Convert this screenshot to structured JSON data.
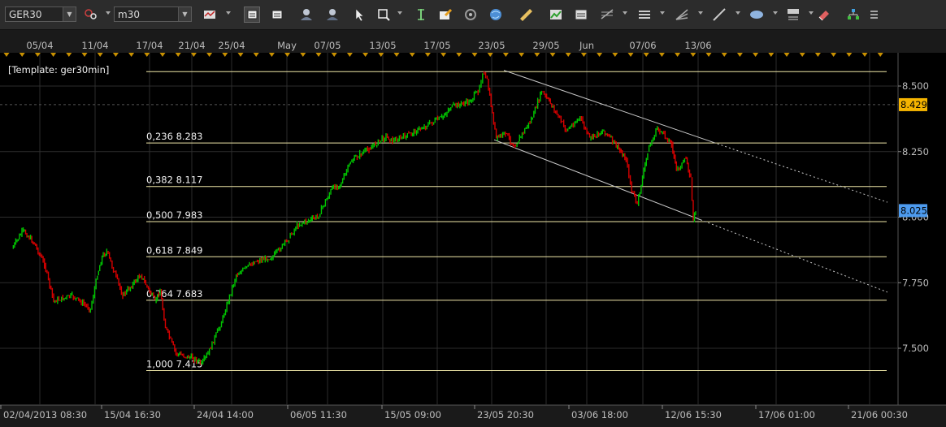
{
  "toolbar": {
    "symbol": "GER30",
    "timeframe": "m30",
    "buttons": [
      "crosshair-icon",
      "bar-type-icon",
      "view-mode-1-icon",
      "view-mode-2-icon",
      "user-icon",
      "user-2-icon",
      "cursor-icon",
      "zoom-icon",
      "vertical-line-icon",
      "edit-icon",
      "refresh-icon",
      "globe-icon",
      "ruler-icon",
      "indicator-icon",
      "drawing-panel-icon",
      "fibonacci-icon",
      "channel-icon",
      "fan-icon",
      "trendline-icon",
      "ellipse-icon",
      "text-label-icon",
      "eraser-icon",
      "tree-icon",
      "menu-icon"
    ]
  },
  "chart_data": {
    "type": "line",
    "instrument": "GER30",
    "timeframe": "m30",
    "template_label": "[Template: ger30min]",
    "y_ticks": [
      "8.500",
      "8.250",
      "8.000",
      "7.750",
      "7.500"
    ],
    "y_tick_values": [
      8500,
      8250,
      8000,
      7750,
      7500
    ],
    "ylim": [
      7360,
      8600
    ],
    "top_time_labels": [
      "05/04",
      "11/04",
      "17/04",
      "21/04",
      "25/04",
      "May",
      "07/05",
      "13/05",
      "17/05",
      "23/05",
      "29/05",
      "Jun",
      "07/06",
      "13/06"
    ],
    "bottom_time_labels": [
      "02/04/2013 08:30",
      "15/04 16:30",
      "24/04 14:00",
      "06/05 11:30",
      "15/05 09:00",
      "23/05 20:30",
      "03/06 18:00",
      "12/06 15:30",
      "17/06 01:00",
      "21/06 00:30"
    ],
    "price_badges": [
      {
        "label": "8.429",
        "value": 8429,
        "color": "#f5b400"
      },
      {
        "label": "8.025",
        "value": 8025,
        "color": "#4d9bef"
      }
    ],
    "fibonacci_levels": [
      {
        "label": "",
        "value": 8555
      },
      {
        "label": "0,236 8.283",
        "value": 8283
      },
      {
        "label": "0,382 8.117",
        "value": 8117
      },
      {
        "label": "0,500 7.983",
        "value": 7983
      },
      {
        "label": "0,618 7.849",
        "value": 7849
      },
      {
        "label": "0,764 7.683",
        "value": 7683
      },
      {
        "label": "1,000 7.415",
        "value": 7415
      }
    ],
    "price_anchors": [
      {
        "date": "02/04",
        "price": 7880
      },
      {
        "date": "03/04",
        "price": 7950
      },
      {
        "date": "04/04",
        "price": 7900
      },
      {
        "date": "05/04",
        "price": 7820
      },
      {
        "date": "06/04",
        "price": 7680
      },
      {
        "date": "08/04",
        "price": 7700
      },
      {
        "date": "10/04",
        "price": 7650
      },
      {
        "date": "11/04",
        "price": 7780
      },
      {
        "date": "12/04",
        "price": 7850
      },
      {
        "date": "13/04",
        "price": 7870
      },
      {
        "date": "15/04",
        "price": 7700
      },
      {
        "date": "16/04",
        "price": 7780
      },
      {
        "date": "17/04",
        "price": 7680
      },
      {
        "date": "18/04",
        "price": 7720
      },
      {
        "date": "18/04",
        "price": 7580
      },
      {
        "date": "19/04",
        "price": 7480
      },
      {
        "date": "21/04",
        "price": 7460
      },
      {
        "date": "22/04",
        "price": 7440
      },
      {
        "date": "23/04",
        "price": 7480
      },
      {
        "date": "24/04",
        "price": 7600
      },
      {
        "date": "25/04",
        "price": 7780
      },
      {
        "date": "27/04",
        "price": 7830
      },
      {
        "date": "29/04",
        "price": 7850
      },
      {
        "date": "01/05",
        "price": 7920
      },
      {
        "date": "03/05",
        "price": 7970
      },
      {
        "date": "06/05",
        "price": 8000
      },
      {
        "date": "07/05",
        "price": 8110
      },
      {
        "date": "08/05",
        "price": 8130
      },
      {
        "date": "09/05",
        "price": 8210
      },
      {
        "date": "10/05",
        "price": 8240
      },
      {
        "date": "11/05",
        "price": 8260
      },
      {
        "date": "13/05",
        "price": 8310
      },
      {
        "date": "14/05",
        "price": 8290
      },
      {
        "date": "15/05",
        "price": 8310
      },
      {
        "date": "16/05",
        "price": 8350
      },
      {
        "date": "17/05",
        "price": 8380
      },
      {
        "date": "18/05",
        "price": 8420
      },
      {
        "date": "20/05",
        "price": 8440
      },
      {
        "date": "21/05",
        "price": 8480
      },
      {
        "date": "22/05",
        "price": 8550
      },
      {
        "date": "22/05",
        "price": 8520
      },
      {
        "date": "23/05",
        "price": 8300
      },
      {
        "date": "24/05",
        "price": 8320
      },
      {
        "date": "25/05",
        "price": 8270
      },
      {
        "date": "27/05",
        "price": 8380
      },
      {
        "date": "28/05",
        "price": 8480
      },
      {
        "date": "29/05",
        "price": 8420
      },
      {
        "date": "30/05",
        "price": 8330
      },
      {
        "date": "31/05",
        "price": 8380
      },
      {
        "date": "01/06",
        "price": 8300
      },
      {
        "date": "03/06",
        "price": 8330
      },
      {
        "date": "04/06",
        "price": 8280
      },
      {
        "date": "05/06",
        "price": 8220
      },
      {
        "date": "06/06",
        "price": 8100
      },
      {
        "date": "06/06",
        "price": 8050
      },
      {
        "date": "07/06",
        "price": 8250
      },
      {
        "date": "08/06",
        "price": 8340
      },
      {
        "date": "10/06",
        "price": 8280
      },
      {
        "date": "10/06",
        "price": 8180
      },
      {
        "date": "11/06",
        "price": 8220
      },
      {
        "date": "12/06",
        "price": 8150
      },
      {
        "date": "12/06",
        "price": 7990
      },
      {
        "date": "12/06",
        "price": 8025
      }
    ]
  },
  "colors": {
    "background": "#000000",
    "grid": "#2d2d2d",
    "bull": "#00c400",
    "bear": "#d80000",
    "fib_line": "#efe7a8",
    "channel": "#c9c9c9",
    "marker": "#c89000",
    "axis_text": "#bdbdbd",
    "label_text": "#f0f0f0"
  }
}
